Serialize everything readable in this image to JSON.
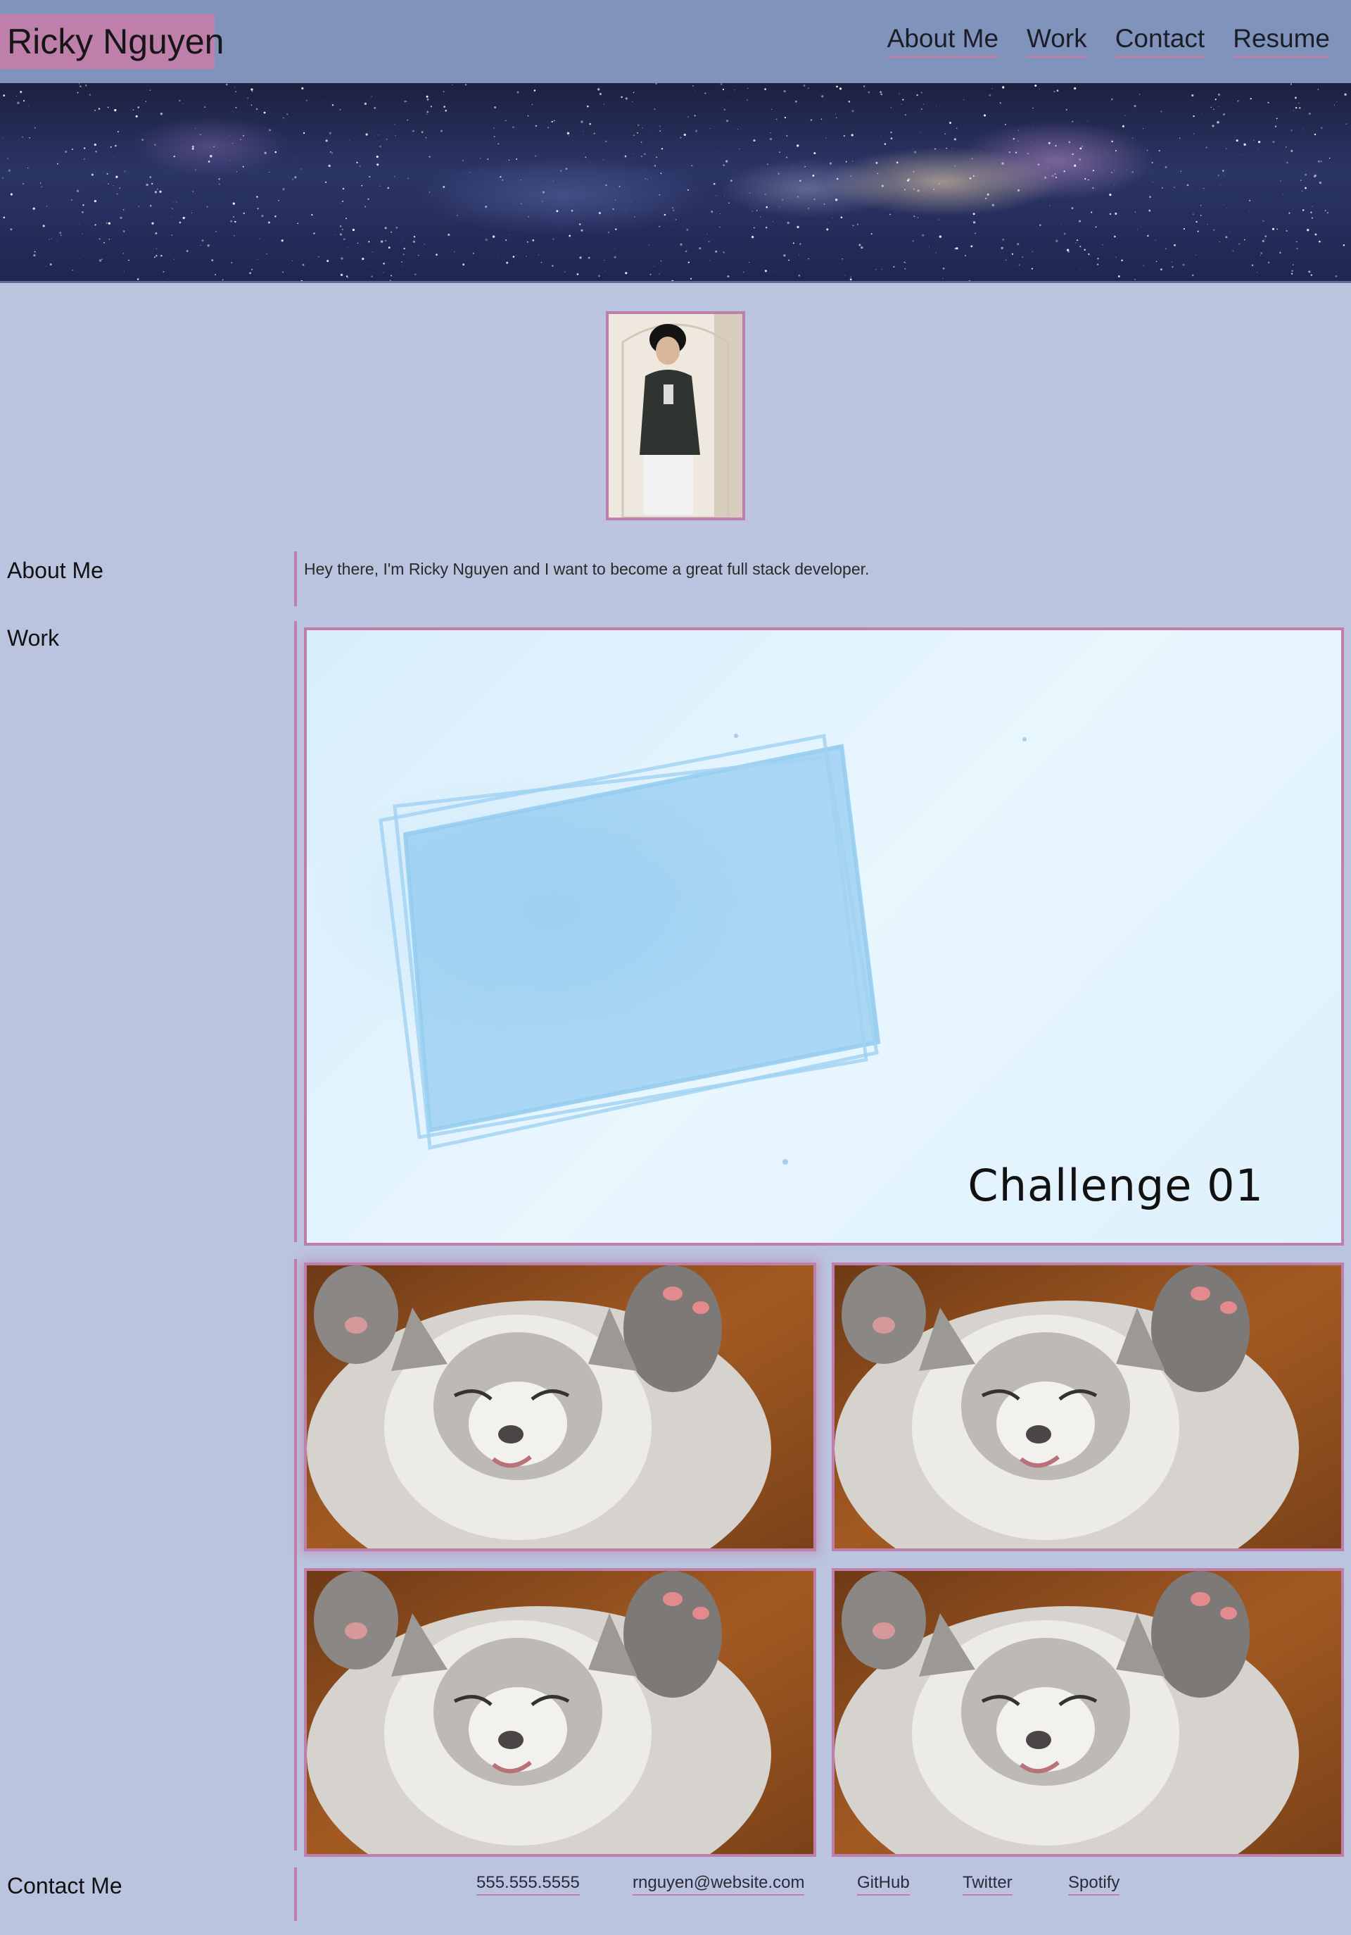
{
  "header": {
    "brand": "Ricky Nguyen",
    "nav": [
      "About Me",
      "Work",
      "Contact",
      "Resume"
    ]
  },
  "sections": {
    "about_title": "About Me",
    "about_text": "Hey there, I'm Ricky Nguyen and I want to become a great full stack developer.",
    "work_title": "Work",
    "work_featured_caption": "Challenge 01",
    "contact_title": "Contact Me"
  },
  "contact": {
    "links": [
      "555.555.5555",
      "rnguyen@website.com",
      "GitHub",
      "Twitter",
      "Spotify"
    ]
  },
  "colors": {
    "background": "#bbc4de",
    "header": "#7f93bb",
    "accent": "#be7fab"
  }
}
